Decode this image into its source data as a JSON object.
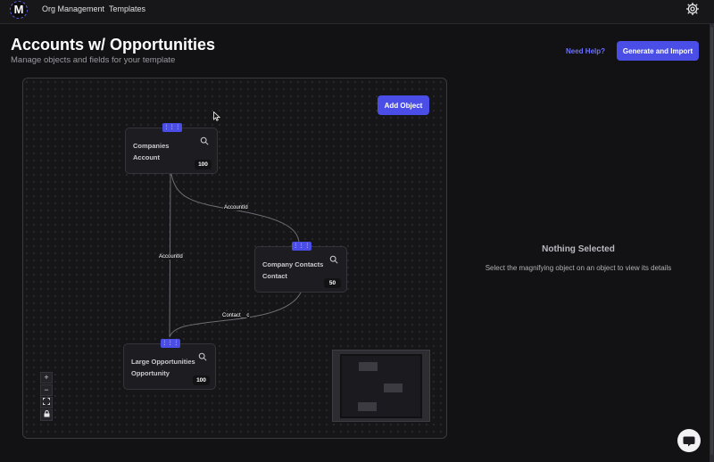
{
  "topbar": {
    "logo_letter": "M",
    "nav": [
      "Org Management",
      "Templates"
    ],
    "settings_icon": "gear-icon"
  },
  "header": {
    "title": "Accounts w/ Opportunities",
    "subtitle": "Manage objects and fields for your template",
    "help_label": "Need Help?",
    "generate_label": "Generate and Import"
  },
  "canvas": {
    "add_object_label": "Add Object",
    "nodes": [
      {
        "label": "Companies",
        "api_name": "Account",
        "count": "100"
      },
      {
        "label": "Company Contacts",
        "api_name": "Contact",
        "count": "50"
      },
      {
        "label": "Large Opportunities",
        "api_name": "Opportunity",
        "count": "100"
      }
    ],
    "edges": [
      "AccountId",
      "AccountId",
      "Contact__c"
    ],
    "controls": [
      "+",
      "−",
      "fit",
      "lock"
    ]
  },
  "details": {
    "title": "Nothing Selected",
    "message": "Select the magnifying object on an object to view its details"
  },
  "colors": {
    "accent": "#4a4ee6",
    "link": "#6b70ff",
    "background": "#121214"
  }
}
